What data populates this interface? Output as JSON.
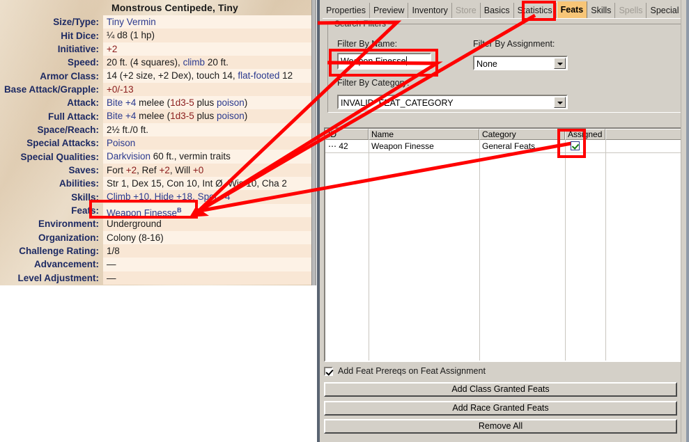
{
  "statblock": {
    "title": "Monstrous Centipede, Tiny",
    "rows": [
      {
        "label": "Size/Type:",
        "value": "Tiny Vermin"
      },
      {
        "label": "Hit Dice:",
        "value": "¼ d8 (1 hp)"
      },
      {
        "label": "Initiative:",
        "value": "+2"
      },
      {
        "label": "Speed:",
        "value": "20 ft. (4 squares), climb 20 ft."
      },
      {
        "label": "Armor Class:",
        "value": "14 (+2 size, +2 Dex), touch 14, flat-footed 12"
      },
      {
        "label": "Base Attack/Grapple:",
        "value": "+0/-13"
      },
      {
        "label": "Attack:",
        "value": "Bite +4 melee (1d3-5 plus poison)"
      },
      {
        "label": "Full Attack:",
        "value": "Bite +4 melee (1d3-5 plus poison)"
      },
      {
        "label": "Space/Reach:",
        "value": "2½ ft./0 ft."
      },
      {
        "label": "Special Attacks:",
        "value": "Poison"
      },
      {
        "label": "Special Qualities:",
        "value": "Darkvision 60 ft., vermin traits"
      },
      {
        "label": "Saves:",
        "value": "Fort +2, Ref +2, Will +0"
      },
      {
        "label": "Abilities:",
        "value": "Str 1, Dex 15, Con 10, Int Ø, Wis 10, Cha 2"
      },
      {
        "label": "Skills:",
        "value": "Climb +10, Hide +18, Spot +4"
      },
      {
        "label": "Feats:",
        "value": "Weapon Finesse"
      },
      {
        "label": "Environment:",
        "value": "Underground"
      },
      {
        "label": "Organization:",
        "value": "Colony (8-16)"
      },
      {
        "label": "Challenge Rating:",
        "value": "1/8"
      },
      {
        "label": "Advancement:",
        "value": "—"
      },
      {
        "label": "Level Adjustment:",
        "value": "—"
      }
    ],
    "feats_superscript": "B"
  },
  "dialog": {
    "tabs": [
      {
        "label": "Properties",
        "state": "normal"
      },
      {
        "label": "Preview",
        "state": "normal"
      },
      {
        "label": "Inventory",
        "state": "normal"
      },
      {
        "label": "Store",
        "state": "disabled"
      },
      {
        "label": "Basics",
        "state": "normal"
      },
      {
        "label": "Statistics",
        "state": "normal"
      },
      {
        "label": "Feats",
        "state": "active"
      },
      {
        "label": "Skills",
        "state": "normal"
      },
      {
        "label": "Spells",
        "state": "disabled"
      },
      {
        "label": "Special Abilit",
        "state": "normal"
      }
    ],
    "tab_nav": {
      "prev": "◁",
      "next": "▶",
      "close": "✕"
    },
    "search_filters": {
      "legend": "Search Filters",
      "name_label": "Filter By Name:",
      "name_value": "Weapon Finesse",
      "assignment_label": "Filter By Assignment:",
      "assignment_value": "None",
      "category_label": "Filter By Category:",
      "category_value": "INVALID_FEAT_CATEGORY"
    },
    "list": {
      "columns": [
        "ID",
        "Name",
        "Category",
        "Assigned",
        ""
      ],
      "rows": [
        {
          "id": "⋯ 42",
          "name": "Weapon Finesse",
          "category": "General Feats",
          "assigned": true
        }
      ]
    },
    "prereq_checkbox": {
      "label": "Add Feat Prereqs on Feat Assignment",
      "checked": true
    },
    "buttons": [
      {
        "label": "Add Class Granted Feats"
      },
      {
        "label": "Add Race Granted Feats"
      },
      {
        "label": "Remove All"
      }
    ]
  },
  "annotations": {
    "color": "#ff0000",
    "boxes": [
      {
        "name": "feats-stat-highlight"
      },
      {
        "name": "feats-tab-highlight"
      },
      {
        "name": "name-filter-highlight"
      },
      {
        "name": "assigned-cell-highlight"
      }
    ]
  }
}
